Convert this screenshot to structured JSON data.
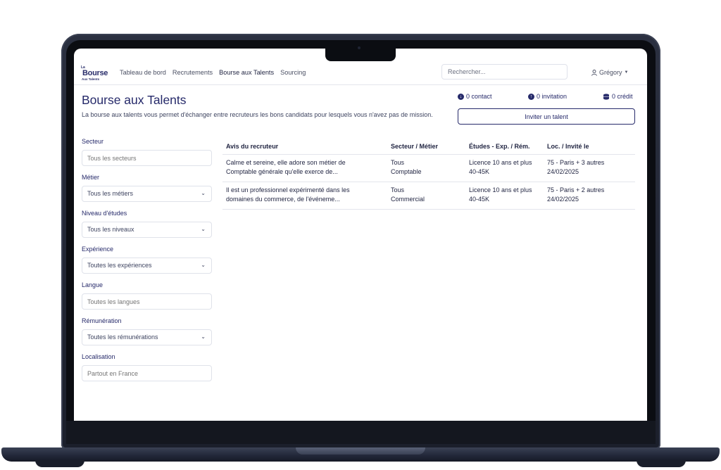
{
  "nav": {
    "logo": {
      "line1": "La",
      "line2": "Bourse",
      "line3": "Aux Talents"
    },
    "links": [
      "Tableau de bord",
      "Recrutements",
      "Bourse aux Talents",
      "Sourcing"
    ],
    "search_placeholder": "Rechercher...",
    "user": "Grégory"
  },
  "page": {
    "title": "Bourse aux Talents",
    "description": "La bourse aux talents vous permet d'échanger entre recruteurs les bons candidats pour lesquels vous n'avez pas de mission.",
    "stats": {
      "contact": "0 contact",
      "invitation": "0 invitation",
      "credit": "0 crédit"
    },
    "invite_button": "Inviter un talent"
  },
  "filters": {
    "secteur": {
      "label": "Secteur",
      "placeholder": "Tous les secteurs"
    },
    "metier": {
      "label": "Métier",
      "value": "Tous les métiers"
    },
    "niveau": {
      "label": "Niveau d'études",
      "value": "Tous les niveaux"
    },
    "experience": {
      "label": "Expérience",
      "value": "Toutes les expériences"
    },
    "langue": {
      "label": "Langue",
      "placeholder": "Toutes les langues"
    },
    "remuneration": {
      "label": "Rémunération",
      "value": "Toutes les rémunérations"
    },
    "localisation": {
      "label": "Localisation",
      "placeholder": "Partout en France"
    }
  },
  "table": {
    "headers": {
      "avis": "Avis du recruteur",
      "secteur": "Secteur / Métier",
      "etudes": "Études - Exp. / Rém.",
      "loc": "Loc. / Invité le"
    },
    "rows": [
      {
        "avis_1": "Calme et sereine, elle adore son métier de",
        "avis_2": "Comptable générale qu'elle exerce de...",
        "secteur": "Tous",
        "metier": "Comptable",
        "etudes": "Licence   10 ans et plus",
        "rem": "40-45K",
        "loc": "75 - Paris + 3 autres",
        "date": "24/02/2025"
      },
      {
        "avis_1": "Il est un professionnel expérimenté dans les",
        "avis_2": "domaines du commerce, de l'événeme...",
        "secteur": "Tous",
        "metier": "Commercial",
        "etudes": "Licence   10 ans et plus",
        "rem": "40-45K",
        "loc": "75 - Paris + 2 autres",
        "date": "24/02/2025"
      }
    ]
  }
}
